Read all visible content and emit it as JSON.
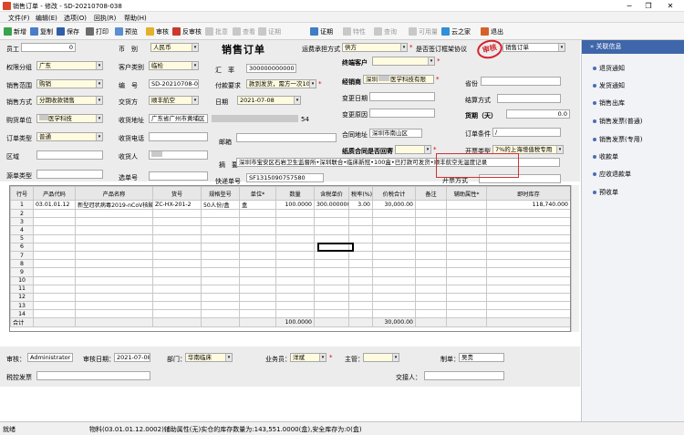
{
  "window": {
    "title": "销售订单 - 修改 - SD-20210708-038"
  },
  "menu": [
    "文件(F)",
    "编辑(E)",
    "选项(O)",
    "回执(R)",
    "帮助(H)"
  ],
  "toolbar": [
    "新增",
    "复制",
    "保存",
    "打印",
    "预览",
    "审核",
    "反审核",
    "批意",
    "查看",
    "证期",
    "证期",
    "特性",
    "查询",
    "可用量",
    "云之家",
    "退出"
  ],
  "form": {
    "title": "销售订单",
    "stamp": "审核",
    "employee": {
      "label": "员工",
      "value": "0"
    },
    "currency": {
      "label": "币　别",
      "value": "人民币"
    },
    "transport": {
      "label": "运费承担方式",
      "value": "供方"
    },
    "contract_signed": {
      "label": "是否签订框架协议"
    },
    "order_type": {
      "value": "销售订单"
    },
    "permission_group": {
      "label": "权限分组",
      "value": "广东"
    },
    "customer_type": {
      "label": "客户类别",
      "value": "临检"
    },
    "exchange_rate": {
      "label": "汇　率",
      "value": "300000000000"
    },
    "end_customer": {
      "label": "终端客户"
    },
    "sales_scope": {
      "label": "销售范围",
      "value": "购销"
    },
    "doc_no": {
      "label": "编　号",
      "value": "SD-20210708-038"
    },
    "payment": {
      "label": "付款要求",
      "value": "款到发货，需方一次100%"
    },
    "dealer": {
      "label": "经销商",
      "value": "深圳",
      "value2": "医学科技有限"
    },
    "province": {
      "label": "省份"
    },
    "sales_method": {
      "label": "销售方式",
      "value": "分期收款销售"
    },
    "delivery_to": {
      "label": "交货方",
      "value": "顺丰航空"
    },
    "date": {
      "label": "日期",
      "value": "2021-07-08"
    },
    "change_date": {
      "label": "变更日期"
    },
    "settle": {
      "label": "结算方式"
    },
    "buyer": {
      "label": "购货单位",
      "value": "医学科技"
    },
    "delivery_addr": {
      "label": "收货地址",
      "value": "广东省广州市黄埔区",
      "tail": "54"
    },
    "change_reason": {
      "label": "变更原因"
    },
    "deadline": {
      "label": "货期（天）",
      "value": "0.0"
    },
    "order_class": {
      "label": "订单类型",
      "value": "普通"
    },
    "recv_phone": {
      "label": "收货电话"
    },
    "mailbox": {
      "label": "邮箱"
    },
    "contract_addr": {
      "label": "合同地址",
      "value": "深圳市南山区"
    },
    "order_cond": {
      "label": "订单条件",
      "value": "/"
    },
    "region": {
      "label": "区域"
    },
    "receiver": {
      "label": "收货人"
    },
    "paper_contract": {
      "label": "纸质合同是否回寄"
    },
    "invoice_type": {
      "label": "开票类型",
      "value": "7%的上海增值税专用"
    },
    "source": {
      "label": "源单类型"
    },
    "source_no": {
      "label": "选单号"
    },
    "summary": {
      "label": "摘　要",
      "value": "深圳市宝安区石岩卫生监督所•深圳联合•临床新冠•100盒•已打款可发货•顺丰航空无温度记录"
    },
    "express": {
      "label": "快递单号",
      "value": "SF1315090757580"
    },
    "invoice_method": {
      "label": "开票方式"
    }
  },
  "grid": {
    "columns": [
      "行号",
      "产品代码",
      "产品名称",
      "货号",
      "规格型号",
      "单位*",
      "数量",
      "含税单价",
      "税率(%)",
      "价税合计",
      "备注",
      "辅助属性*",
      "即时库存"
    ],
    "rows": [
      {
        "no": "1",
        "code": "03.01.01.12",
        "name": "新型冠状病毒2019-nCoV核酸检测试剂盒",
        "item": "ZC-HX-201-2",
        "spec": "50人份/盒",
        "unit": "盒",
        "qty": "100.0000",
        "price": "300.000000",
        "tax": "3.00",
        "total": "30,000.00",
        "note": "",
        "aux": "",
        "stock": "118,740.000"
      }
    ],
    "empty_rows": [
      "2",
      "3",
      "4",
      "5",
      "6",
      "7",
      "8",
      "9",
      "10",
      "11",
      "12",
      "13",
      "14"
    ],
    "total": {
      "label": "合计",
      "qty": "100.0000",
      "total": "30,000.00"
    }
  },
  "footer": {
    "auditor": {
      "label": "审核：",
      "value": "Administrator"
    },
    "audit_date": {
      "label": "审核日期：",
      "value": "2021-07-08"
    },
    "dept": {
      "label": "部门：",
      "value": "华南临床"
    },
    "salesman": {
      "label": "业务员：",
      "value": "洋斌"
    },
    "supervisor": {
      "label": "主管："
    },
    "maker": {
      "label": "制单：",
      "value": "吴贵"
    },
    "tax_invoice": {
      "label": "税控发票"
    },
    "handover": {
      "label": "交接人："
    }
  },
  "panel": {
    "title": "关联信息",
    "items": [
      "退货通知",
      "发货通知",
      "销售出库",
      "销售发票(普通)",
      "销售发票(专用)",
      "收款单",
      "应收退款单",
      "预收单"
    ]
  },
  "status": {
    "left": "就绪",
    "msg": "物料(03.01.01.12.0002)辅助属性(无)实仓的库存数量为:143,551.0000(盒),安全库存为:0(盒)"
  },
  "colors": {
    "accent": "#3f66aa",
    "stamp": "#d4242d"
  }
}
